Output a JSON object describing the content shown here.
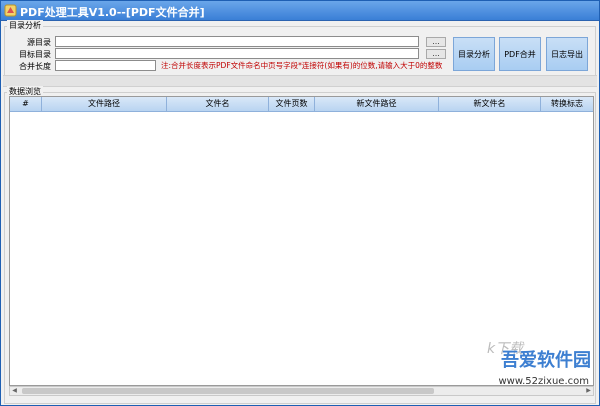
{
  "window": {
    "title": "PDF处理工具V1.0--[PDF文件合并]",
    "accent": "#3a7fd6"
  },
  "directory_section": {
    "title": "目录分析",
    "fields": [
      {
        "label": "源目录",
        "value": "",
        "browse": "..."
      },
      {
        "label": "目标目录",
        "value": "",
        "browse": "..."
      },
      {
        "label": "合并长度",
        "value": ""
      }
    ],
    "note": "注:合并长度表示PDF文件命名中页号字段*连接符(如果有)的位数,请输入大于0的整数",
    "note_color": "#c00000",
    "buttons": [
      "目录分析",
      "PDF合并",
      "日志导出"
    ]
  },
  "data_section": {
    "title": "数据浏览",
    "columns": [
      "#",
      "文件路径",
      "文件名",
      "文件页数",
      "新文件路径",
      "新文件名",
      "转换标志"
    ]
  },
  "watermark": {
    "top": "k下载",
    "brand": "吾爱软件园",
    "url": "www.52zixue.com"
  }
}
